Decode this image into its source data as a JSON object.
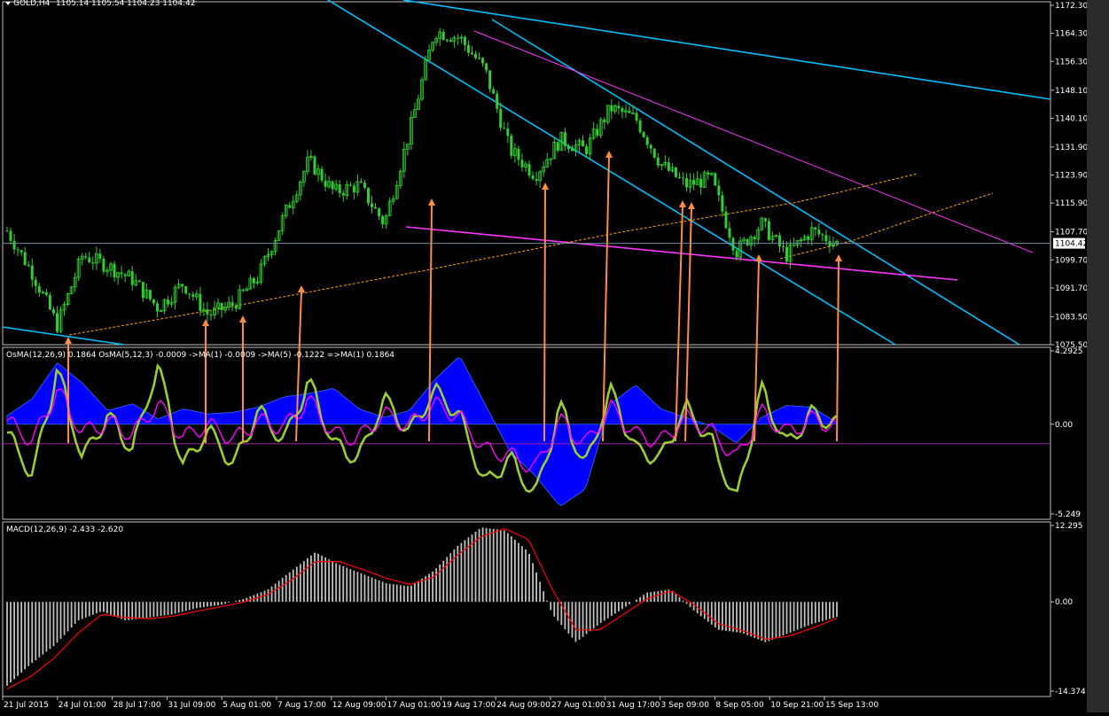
{
  "header": {
    "symbol_text": "GOLD,H4",
    "ohlc_text": "1105.14 1105.54 1104.23 1104.42"
  },
  "price_axis": {
    "ticks": [
      "1172.30",
      "1164.30",
      "1156.30",
      "1148.10",
      "1140.10",
      "1131.90",
      "1123.90",
      "1115.90",
      "1107.70",
      "1099.70",
      "1091.70",
      "1083.50",
      "1075.50"
    ],
    "current": "1104.42"
  },
  "osma_pane": {
    "label": "OsMA(12,26,9) 0.1864  OsMA(5,12,3) -0.0009  ->MA(1) -0.0009  ->MA(5) -0.1222  =>MA(1) 0.1864",
    "ticks": [
      "4.2925",
      "0.00",
      "-5.249"
    ]
  },
  "macd_pane": {
    "label": "MACD(12,26,9) -2.433 -2.620",
    "ticks": [
      "12.295",
      "0.00",
      "-14.374"
    ]
  },
  "time_axis": {
    "labels": [
      "21 Jul 2015",
      "24 Jul 01:00",
      "28 Jul 17:00",
      "31 Jul 09:00",
      "5 Aug 01:00",
      "7 Aug 17:00",
      "12 Aug 09:00",
      "17 Aug 01:00",
      "19 Aug 17:00",
      "24 Aug 09:00",
      "27 Aug 01:00",
      "31 Aug 17:00",
      "3 Sep 09:00",
      "8 Sep 05:00",
      "10 Sep 21:00",
      "15 Sep 13:00"
    ]
  },
  "colors": {
    "background": "#000000",
    "candle": "#32cd32",
    "trendline_blue": "#00bfff",
    "trendline_magenta": "#ff33ff",
    "ma_dotted": "#ffa500",
    "arrow": "#ff8c40",
    "osma_hist": "#0000ff",
    "osma_fast": "#9acd32",
    "osma_signal": "#ff00ff",
    "macd_hist": "#c0c0c0",
    "macd_signal": "#ff0000"
  },
  "chart_data": [
    {
      "type": "candlestick",
      "title": "GOLD,H4",
      "ylim": [
        1075.5,
        1172.3
      ],
      "x": [
        "21 Jul 2015",
        "24 Jul 01:00",
        "28 Jul 17:00",
        "31 Jul 09:00",
        "5 Aug 01:00",
        "7 Aug 17:00",
        "12 Aug 09:00",
        "17 Aug 01:00",
        "19 Aug 17:00",
        "24 Aug 09:00",
        "27 Aug 01:00",
        "31 Aug 17:00",
        "3 Sep 09:00",
        "8 Sep 05:00",
        "10 Sep 21:00",
        "15 Sep 13:00"
      ],
      "close_path": [
        1108,
        1096,
        1081,
        1101,
        1098,
        1094,
        1086,
        1093,
        1084,
        1087,
        1095,
        1112,
        1128,
        1119,
        1121,
        1110,
        1136,
        1165,
        1163,
        1154,
        1131,
        1124,
        1134,
        1131,
        1143,
        1140,
        1127,
        1121,
        1123,
        1102,
        1110,
        1101,
        1108,
        1104.42
      ],
      "current": 1104.42
    },
    {
      "type": "line",
      "title": "OsMA(12,26,9)",
      "ylim": [
        -5.249,
        4.2925
      ],
      "series": [
        {
          "name": "OsMA(12,26,9)",
          "values": [
            0.5,
            1.5,
            3.6,
            2.4,
            0.8,
            1.2,
            0.3,
            0.9,
            0.6,
            0.7,
            1.0,
            1.6,
            1.8,
            2.1,
            0.9,
            0.4,
            0.8,
            2.6,
            4.0,
            1.2,
            -1.6,
            -3.0,
            -4.8,
            -3.8,
            1.2,
            2.3,
            0.9,
            0.4,
            -0.1,
            -1.1,
            0.4,
            1.1,
            1.0,
            0.1
          ]
        },
        {
          "name": "OsMA(5,12,3)",
          "values": [
            -0.5,
            -3.0,
            3.2,
            -2.0,
            0.5,
            -1.5,
            3.5,
            -2.5,
            -0.3,
            -2.4,
            0.8,
            -1.0,
            2.5,
            -1.2,
            -2.0,
            1.5,
            -0.5,
            2.0,
            0.5,
            -3.5,
            -2.0,
            -4.2,
            1.0,
            -2.5,
            2.0,
            -1.5,
            -2.0,
            1.0,
            -1.0,
            -4.5,
            2.0,
            -1.2,
            0.6,
            -0.0009
          ]
        },
        {
          "name": "MA(5)",
          "values": [
            0.2,
            -1.0,
            2.0,
            -0.5,
            0.1,
            -0.6,
            1.2,
            -0.8,
            0.0,
            -0.9,
            0.2,
            -0.2,
            1.4,
            -0.6,
            -0.8,
            0.6,
            -0.1,
            1.2,
            0.4,
            -1.5,
            -1.8,
            -2.6,
            0.2,
            -1.2,
            1.0,
            -0.6,
            -1.0,
            0.4,
            -0.4,
            -2.0,
            0.7,
            -0.5,
            0.3,
            -0.1222
          ]
        }
      ]
    },
    {
      "type": "bar",
      "title": "MACD(12,26,9)",
      "ylim": [
        -14.374,
        12.295
      ],
      "series": [
        {
          "name": "MACD",
          "values": [
            -13.5,
            -10.0,
            -7.0,
            -3.0,
            -1.5,
            -3.0,
            -2.5,
            -2.0,
            -1.0,
            -0.5,
            0.5,
            2.0,
            5.0,
            8.0,
            6.0,
            4.5,
            3.0,
            2.5,
            5.0,
            9.0,
            12.0,
            11.5,
            8.0,
            -2.0,
            -6.5,
            -3.5,
            -1.0,
            1.5,
            2.0,
            -1.5,
            -4.5,
            -5.0,
            -6.5,
            -5.0,
            -3.5,
            -2.433
          ]
        },
        {
          "name": "Signal",
          "values": [
            -14.0,
            -12.0,
            -9.0,
            -5.0,
            -2.0,
            -2.5,
            -2.7,
            -2.3,
            -1.5,
            -0.8,
            0.0,
            1.2,
            3.5,
            6.5,
            6.5,
            5.2,
            3.8,
            2.8,
            4.0,
            7.5,
            10.5,
            11.8,
            10.0,
            2.0,
            -4.5,
            -4.5,
            -2.0,
            0.5,
            1.8,
            -0.5,
            -3.5,
            -4.6,
            -6.0,
            -5.5,
            -4.2,
            -2.62
          ]
        }
      ]
    }
  ]
}
